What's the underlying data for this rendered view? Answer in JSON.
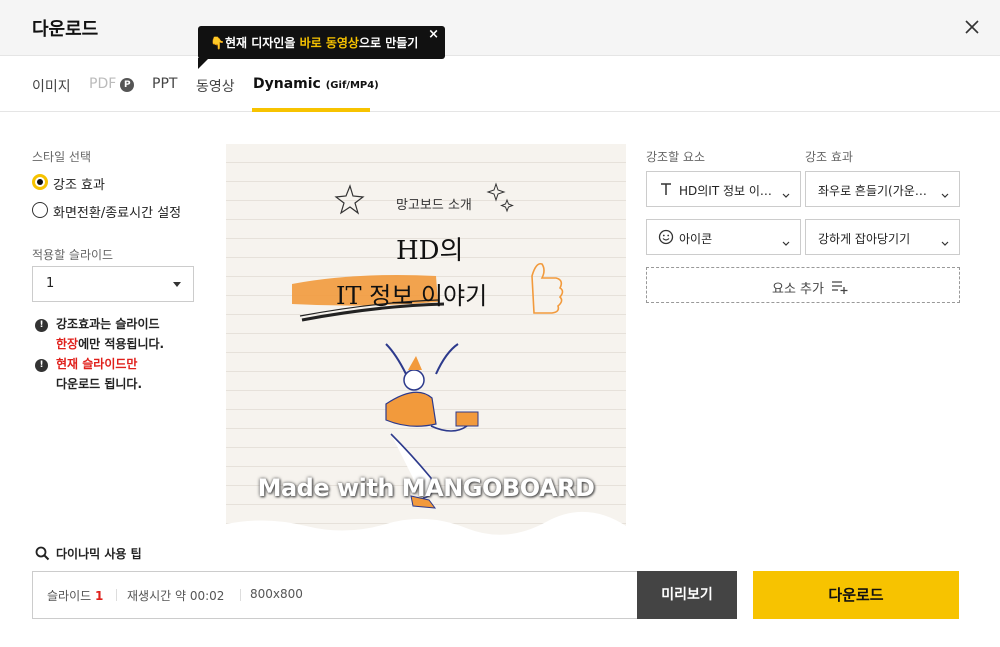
{
  "header": {
    "title": "다운로드",
    "close_icon": "close-icon"
  },
  "tooltip": {
    "pre": "현재 디자인을 ",
    "highlight": "바로 동영상",
    "post": "으로 만들기",
    "icon": "pointing-finger-icon"
  },
  "tabs": [
    {
      "label": "이미지"
    },
    {
      "label": "PDF",
      "badge": "P"
    },
    {
      "label": "PPT"
    },
    {
      "label": "동영상"
    },
    {
      "label": "Dynamic",
      "sub": "(Gif/MP4)"
    }
  ],
  "left": {
    "style_label": "스타일 선택",
    "radio_options": [
      "강조 효과",
      "화면전환/종료시간 설정"
    ],
    "selected_radio": "강조 효과",
    "slide_label": "적용할 슬라이드",
    "slide_value": "1",
    "note1": {
      "line1": "강조효과는 슬라이드",
      "red": "한장",
      "line2rest": "에만 적용됩니다."
    },
    "note2": {
      "red": "현재 슬라이드만",
      "line2": "다운로드 됩니다."
    }
  },
  "preview": {
    "small_title": "망고보드 소개",
    "hd_title": "HD의",
    "it_title": "IT 정보 이야기",
    "watermark": "Made with MANGOBOARD"
  },
  "right": {
    "element_label": "강조할 요소",
    "effect_label": "강조 효과",
    "rows": [
      {
        "element": "HD의IT 정보 이…",
        "element_icon": "text-icon",
        "effect": "좌우로 흔들기(가운…"
      },
      {
        "element": "아이콘",
        "element_icon": "smiley-icon",
        "effect": "강하게 잡아당기기"
      }
    ],
    "add_label": "요소 추가"
  },
  "tip_label": "다이나믹 사용 팁",
  "info": {
    "slide_label": "슬라이드",
    "slide_num": "1",
    "playtime": "재생시간 약 00:02",
    "size": "800x800"
  },
  "buttons": {
    "preview": "미리보기",
    "download": "다운로드"
  }
}
